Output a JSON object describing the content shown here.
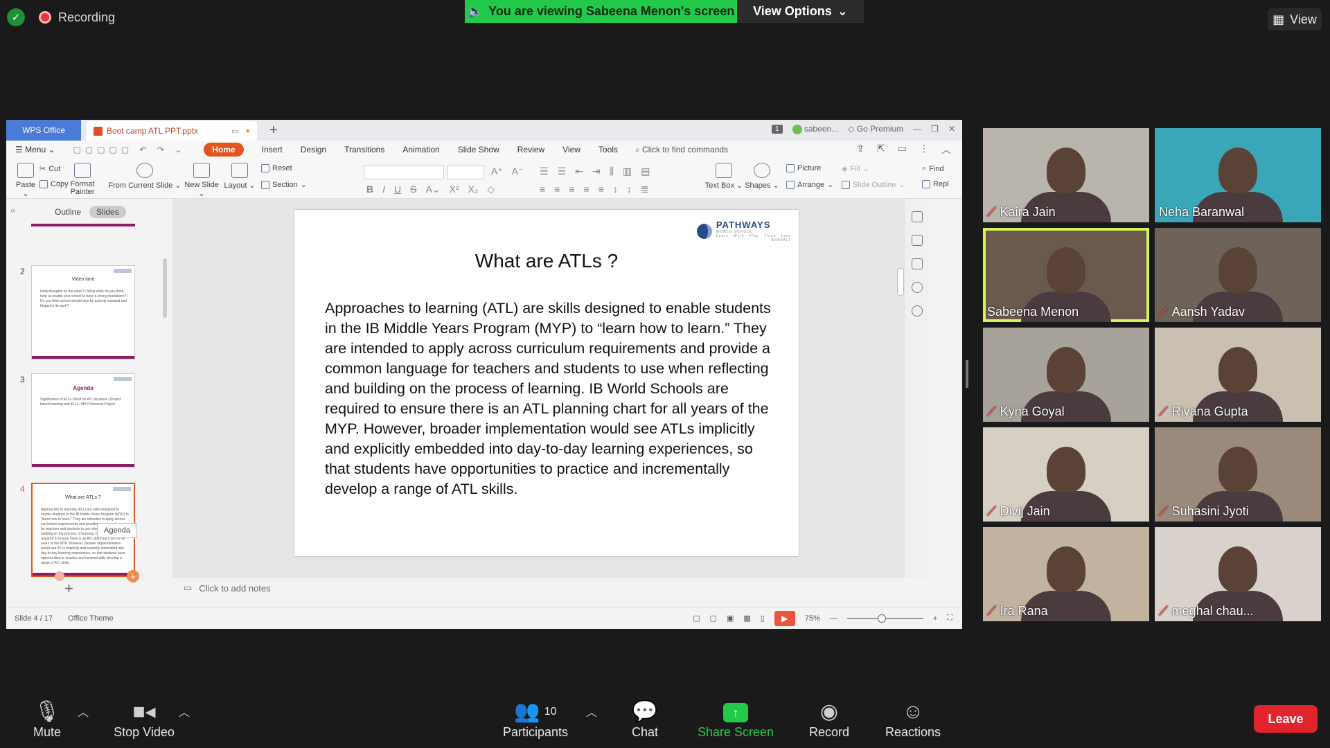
{
  "zoom": {
    "recording_label": "Recording",
    "viewing_banner": "You are viewing Sabeena Menon's screen",
    "view_options": "View Options",
    "view_label": "View",
    "toolbar": {
      "mute": "Mute",
      "stop_video": "Stop Video",
      "participants": "Participants",
      "participants_count": "10",
      "chat": "Chat",
      "share_screen": "Share Screen",
      "record": "Record",
      "reactions": "Reactions",
      "leave": "Leave"
    },
    "participants": [
      {
        "name": "Kaira Jain",
        "muted": true,
        "bg": "#b9b5ad"
      },
      {
        "name": "Neha Baranwal",
        "muted": false,
        "bg": "#3aa7b8"
      },
      {
        "name": "Sabeena Menon",
        "muted": false,
        "bg": "#6a5a4e"
      },
      {
        "name": "Aansh Yadav",
        "muted": true,
        "bg": "#6e6358"
      },
      {
        "name": "Kyna Goyal",
        "muted": true,
        "bg": "#a8a39a"
      },
      {
        "name": "Riyana Gupta",
        "muted": true,
        "bg": "#c9c0b1"
      },
      {
        "name": "Divij Jain",
        "muted": true,
        "bg": "#d6cfc4"
      },
      {
        "name": "Suhasini Jyoti",
        "muted": true,
        "bg": "#9a8a7c"
      },
      {
        "name": "Ira Rana",
        "muted": true,
        "bg": "#c2b3a0"
      },
      {
        "name": "meghal chau...",
        "muted": true,
        "bg": "#d9d1cc"
      }
    ]
  },
  "wps": {
    "app_tab": "WPS Office",
    "file_tab": "Boot camp ATL PPT.pptx",
    "page_badge": "1",
    "user": "sabeen...",
    "go_premium": "Go Premium",
    "menu": {
      "menu_label": "Menu",
      "tabs": [
        "Home",
        "Insert",
        "Design",
        "Transitions",
        "Animation",
        "Slide Show",
        "Review",
        "View",
        "Tools"
      ],
      "search": "Click to find commands"
    },
    "ribbon": {
      "paste": "Paste",
      "cut": "Cut",
      "copy": "Copy",
      "format_painter": "Format Painter",
      "from_current_slide": "From Current Slide",
      "new_slide": "New Slide",
      "layout": "Layout",
      "reset": "Reset",
      "section": "Section",
      "text_box": "Text Box",
      "shapes": "Shapes",
      "picture": "Picture",
      "fill": "Fill",
      "arrange": "Arrange",
      "slide_outline": "Slide Outline",
      "find": "Find",
      "replace": "Repl"
    },
    "panel": {
      "outline": "Outline",
      "slides": "Slides",
      "tooltip": "Agenda"
    },
    "thumbnails": [
      {
        "num": "2",
        "title": "Video time",
        "lines": "Initial thoughts on the video? / What skills do you think, help us enable your school to have a strong foundation? / Do you think school should also be actively invested and hinged in its work?"
      },
      {
        "num": "3",
        "title": "Agenda",
        "lines": "Significance of ATLs / Brief on ATL structure / Project based learning and ATLs / MYP Personal Project"
      },
      {
        "num": "4",
        "title": "What are ATLs ?",
        "lines": "Approaches to learning (ATL) are skills designed to enable students in the IB Middle Years Program (MYP) to \"learn how to learn.\" They are intended to apply across curriculum requirements and provide a common language for teachers and students to use when reflecting and building on the process of learning. IB World Schools are required to ensure there is an ATL planning chart for all years of the MYP. However, broader implementation would see ATLs implicitly and explicitly embedded into day-to-day learning experiences, so that students have opportunities to practice and incrementally develop a range of ATL skills."
      }
    ],
    "slide": {
      "logo_name": "PATHWAYS",
      "logo_sub": "WORLD SCHOOL",
      "logo_tag": "Learn · Work · Play · Think · Live",
      "logo_place": "ARAVALI",
      "title": "What are ATLs ?",
      "body": "Approaches to learning (ATL) are skills designed to enable students in the IB Middle Years Program (MYP) to “learn how to learn.” They are intended to apply across curriculum requirements and provide a common language for teachers and students to use when reflecting and building on the process of learning. IB World Schools are required to ensure there is an ATL planning chart for all years of the MYP. However, broader implementation would see ATLs implicitly and explicitly embedded into day-to-day learning experiences, so that students have opportunities to practice and incrementally develop a range of ATL skills."
    },
    "notes_placeholder": "Click to add notes",
    "status": {
      "slide_of": "Slide 4 / 17",
      "theme": "Office Theme",
      "zoom": "75%"
    }
  }
}
